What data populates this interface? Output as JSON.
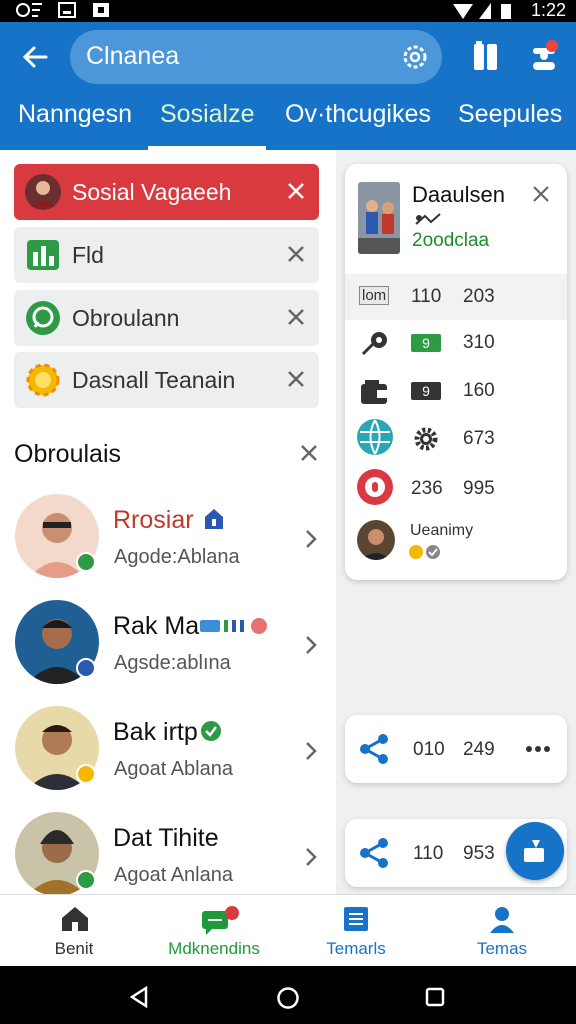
{
  "status_bar": {
    "time": "1:22"
  },
  "app_bar": {
    "search_text": "Clnanea",
    "tabs": [
      {
        "label": "Nanngesn"
      },
      {
        "label": "Sosialze"
      },
      {
        "label": "Ov·thcugikes"
      },
      {
        "label": "Seepules"
      }
    ],
    "active_tab": 1
  },
  "filters": [
    {
      "label": "Sosial Vagaeeh",
      "icon": "avatar-icon",
      "active": true
    },
    {
      "label": "Fld",
      "icon": "chart-icon"
    },
    {
      "label": "Obroulann",
      "icon": "whatsapp-icon"
    },
    {
      "label": "Dasnall Teanain",
      "icon": "sun-icon"
    }
  ],
  "section": {
    "title": "Obroulais"
  },
  "people": [
    {
      "name": "Rrosiar",
      "subtitle": "Agode:Ablana"
    },
    {
      "name": "Rak Ma",
      "subtitle": "Agsde:ablına"
    },
    {
      "name": "Bak irtp",
      "subtitle": "Agoat Ablana"
    },
    {
      "name": "Dat Tihite",
      "subtitle": "Agoat Anlana"
    }
  ],
  "card": {
    "title": "Daaulsen",
    "subtitle": "2oodclaa",
    "rows": [
      {
        "tag": "lom",
        "v1": "110",
        "v2": "203"
      },
      {
        "tag": "9",
        "v2": "310"
      },
      {
        "tag": "9",
        "v2": "160"
      },
      {
        "v2": "673"
      },
      {
        "v1": "236",
        "v2": "995"
      }
    ],
    "footer": "Ueanimy"
  },
  "mini_cards": [
    {
      "v1": "010",
      "v2": "249"
    },
    {
      "v1": "110",
      "v2": "953"
    }
  ],
  "bottom_nav": [
    {
      "label": "Benit",
      "color": "#333333"
    },
    {
      "label": "Mdknendins",
      "color": "#1f9a3a"
    },
    {
      "label": "Temarls",
      "color": "#1673c8"
    },
    {
      "label": "Temas",
      "color": "#1673c8"
    }
  ],
  "colors": {
    "primary": "#1673c8",
    "danger": "#d93a3f",
    "success": "#1f8a2a"
  }
}
